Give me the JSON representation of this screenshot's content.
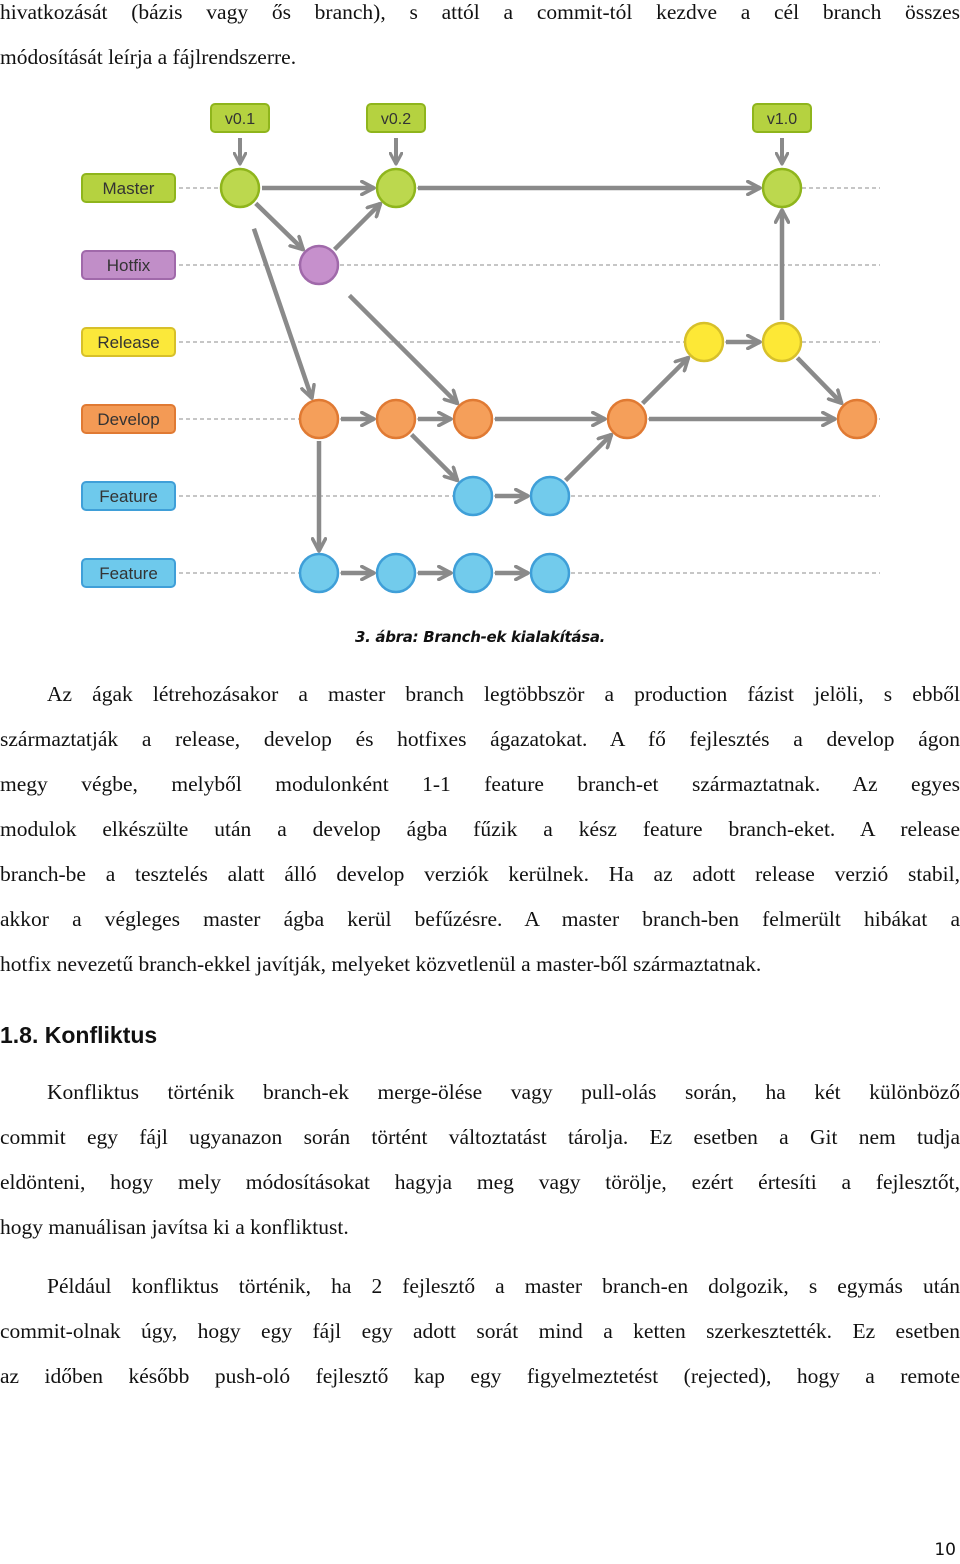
{
  "intro_lines": [
    "hivatkozását (bázis vagy ős branch), s attól a commit-tól kezdve a cél branch összes",
    "módosítását leírja a fájlrendszerre."
  ],
  "figure": {
    "branches": [
      {
        "label": "Master",
        "fill": "#b5d240",
        "stroke": "#8fb51c",
        "node_fill": "#bcd84e"
      },
      {
        "label": "Hotfix",
        "fill": "#c18ec8",
        "stroke": "#a069aa",
        "node_fill": "#c690cc"
      },
      {
        "label": "Release",
        "fill": "#fbe83a",
        "stroke": "#d7c02a",
        "node_fill": "#fde836"
      },
      {
        "label": "Develop",
        "fill": "#f39a55",
        "stroke": "#e07a33",
        "node_fill": "#f59f5a"
      },
      {
        "label": "Feature",
        "fill": "#6ec9ec",
        "stroke": "#3f9fd8",
        "node_fill": "#72cbec"
      },
      {
        "label": "Feature",
        "fill": "#6ec9ec",
        "stroke": "#3f9fd8",
        "node_fill": "#72cbec"
      }
    ],
    "tags": [
      {
        "label": "v0.1",
        "branch": 0,
        "column": 0
      },
      {
        "label": "v0.2",
        "branch": 0,
        "column": 2
      },
      {
        "label": "v1.0",
        "branch": 0,
        "column": 7
      }
    ],
    "commits": [
      {
        "id": "m1",
        "branch": 0,
        "column": 0
      },
      {
        "id": "m2",
        "branch": 0,
        "column": 2
      },
      {
        "id": "m3",
        "branch": 0,
        "column": 7
      },
      {
        "id": "h1",
        "branch": 1,
        "column": 1
      },
      {
        "id": "r1",
        "branch": 2,
        "column": 6
      },
      {
        "id": "r2",
        "branch": 2,
        "column": 7
      },
      {
        "id": "d1",
        "branch": 3,
        "column": 1
      },
      {
        "id": "d2",
        "branch": 3,
        "column": 2
      },
      {
        "id": "d3",
        "branch": 3,
        "column": 3
      },
      {
        "id": "d4",
        "branch": 3,
        "column": 5
      },
      {
        "id": "d5",
        "branch": 3,
        "column": 8
      },
      {
        "id": "fa1",
        "branch": 4,
        "column": 3
      },
      {
        "id": "fa2",
        "branch": 4,
        "column": 4
      },
      {
        "id": "fb1",
        "branch": 5,
        "column": 1
      },
      {
        "id": "fb2",
        "branch": 5,
        "column": 2
      },
      {
        "id": "fb3",
        "branch": 5,
        "column": 3
      },
      {
        "id": "fb4",
        "branch": 5,
        "column": 4
      }
    ],
    "edges": [
      [
        "m1",
        "m2"
      ],
      [
        "m2",
        "m3"
      ],
      [
        "m1",
        "h1"
      ],
      [
        "h1",
        "m2"
      ],
      [
        "m1",
        "d1"
      ],
      [
        "h1",
        "d3"
      ],
      [
        "d1",
        "d2"
      ],
      [
        "d2",
        "d3"
      ],
      [
        "d3",
        "d4"
      ],
      [
        "d4",
        "d5"
      ],
      [
        "d2",
        "fa1"
      ],
      [
        "fa1",
        "fa2"
      ],
      [
        "fa2",
        "d4"
      ],
      [
        "d1",
        "fb1"
      ],
      [
        "fb1",
        "fb2"
      ],
      [
        "fb2",
        "fb3"
      ],
      [
        "fb3",
        "fb4"
      ],
      [
        "d4",
        "r1"
      ],
      [
        "r1",
        "r2"
      ],
      [
        "r2",
        "m3"
      ],
      [
        "r2",
        "d5"
      ]
    ],
    "caption": "3. ábra: Branch-ek kialakítása."
  },
  "paragraph1_lines": [
    "Az ágak létrehozásakor a master branch legtöbbször a production fázist jelöli, s ebből",
    "származtatják a release, develop és hotfixes ágazatokat. A fő fejlesztés a develop ágon",
    "megy végbe, melyből modulonként 1-1 feature branch-et származtatnak. Az egyes",
    "modulok elkészülte után a develop ágba fűzik a kész feature branch-eket. A release",
    "branch-be a tesztelés alatt álló develop verziók kerülnek. Ha az adott release verzió stabil,",
    "akkor a végleges master ágba kerül befűzésre. A master branch-ben felmerült hibákat a",
    "hotfix nevezetű branch-ekkel javítják, melyeket közvetlenül a master-ből származtatnak."
  ],
  "section_heading": "1.8. Konfliktus",
  "paragraph2_lines": [
    "Konfliktus történik branch-ek merge-ölése vagy pull-olás során, ha két különböző",
    "commit egy fájl ugyanazon során történt változtatást tárolja. Ez esetben a Git nem tudja",
    "eldönteni, hogy mely módosításokat hagyja meg vagy törölje, ezért értesíti a fejlesztőt,",
    "hogy manuálisan javítsa ki a konfliktust."
  ],
  "paragraph3_lines": [
    "Például konfliktus történik, ha 2 fejlesztő a master branch-en dolgozik, s egymás után",
    "commit-olnak úgy, hogy egy fájl egy adott sorát mind a ketten szerkesztették. Ez esetben",
    "az időben később push-oló fejlesztő kap egy figyelmeztetést (rejected), hogy a remote"
  ],
  "page_number": "10"
}
